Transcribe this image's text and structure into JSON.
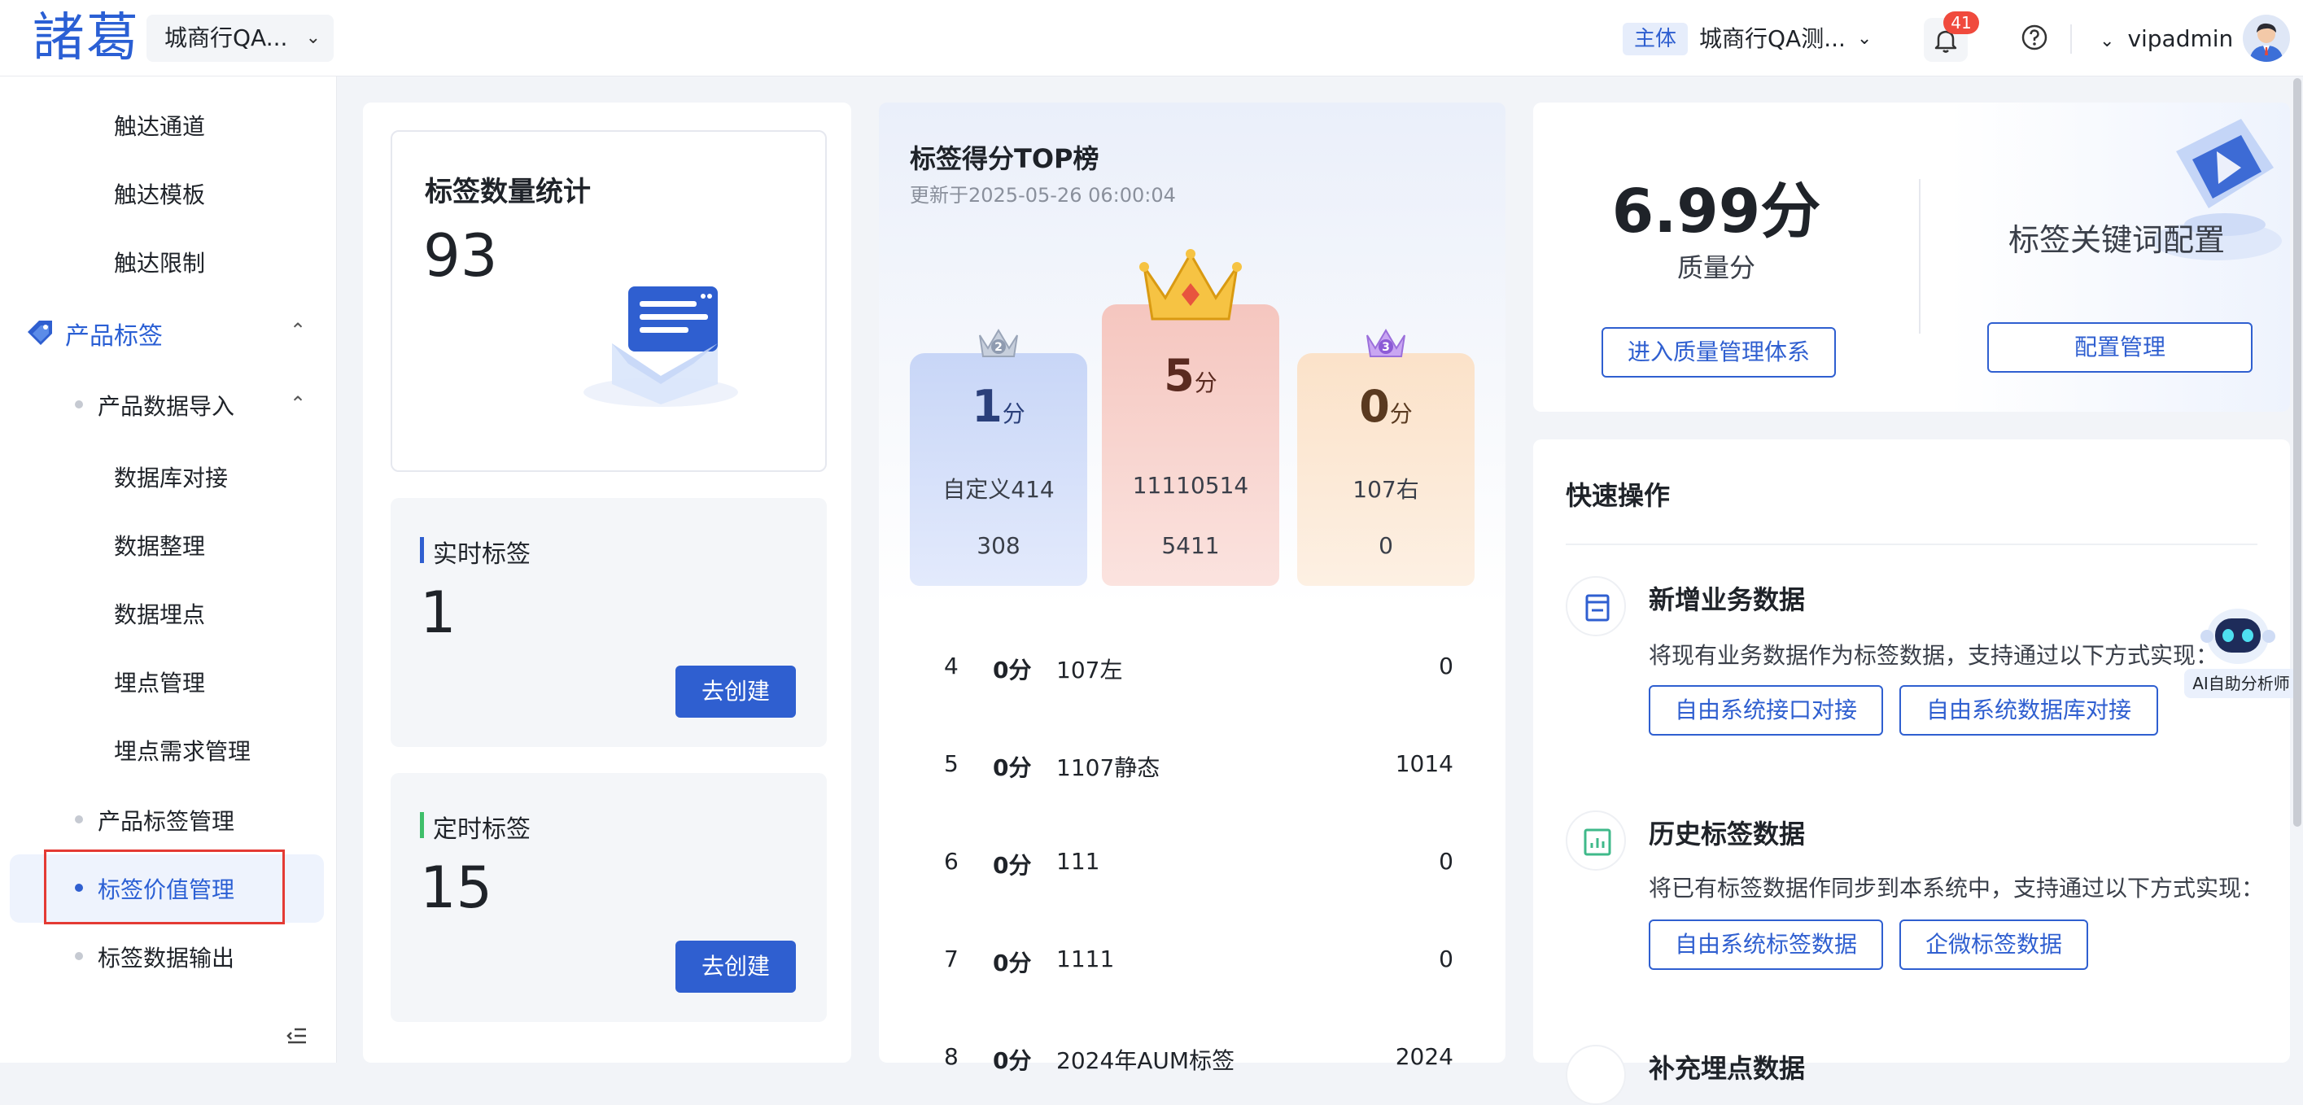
{
  "header": {
    "logo": "諸葛",
    "org": "城商行QA...",
    "entity_tag": "主体",
    "entity_name": "城商行QA测...",
    "notifications": "41",
    "user": "vipadmin"
  },
  "sidebar": {
    "items_top": [
      "触达通道",
      "触达模板",
      "触达限制"
    ],
    "group": "产品标签",
    "sub_group": "产品数据导入",
    "sub_items": [
      "数据库对接",
      "数据整理",
      "数据埋点",
      "埋点管理",
      "埋点需求管理"
    ],
    "l2_items": [
      "产品标签管理",
      "标签价值管理",
      "标签数据输出"
    ]
  },
  "stats": {
    "title": "标签数量统计",
    "total": "93",
    "realtime": {
      "label": "实时标签",
      "value": "1",
      "btn": "去创建"
    },
    "scheduled": {
      "label": "定时标签",
      "value": "15",
      "btn": "去创建"
    }
  },
  "top": {
    "title": "标签得分TOP榜",
    "updated": "更新于2025-05-26 06:00:04",
    "score_unit": "分",
    "podium": [
      {
        "rank": "2",
        "score": "1",
        "name": "自定义414",
        "count": "308"
      },
      {
        "rank": "1",
        "score": "5",
        "name": "11110514",
        "count": "5411"
      },
      {
        "rank": "3",
        "score": "0",
        "name": "107右",
        "count": "0"
      }
    ],
    "rows": [
      {
        "rank": "4",
        "score": "0分",
        "name": "107左",
        "count": "0"
      },
      {
        "rank": "5",
        "score": "0分",
        "name": "1107静态",
        "count": "1014"
      },
      {
        "rank": "6",
        "score": "0分",
        "name": "111",
        "count": "0"
      },
      {
        "rank": "7",
        "score": "0分",
        "name": "1111",
        "count": "0"
      },
      {
        "rank": "8",
        "score": "0分",
        "name": "2024年AUM标签",
        "count": "2024"
      }
    ]
  },
  "quality": {
    "value": "6.99分",
    "label": "质量分",
    "btn": "进入质量管理体系",
    "kw_title": "标签关键词配置",
    "kw_btn": "配置管理"
  },
  "quick": {
    "title": "快速操作",
    "actions": [
      {
        "title": "新增业务数据",
        "desc": "将现有业务数据作为标签数据，支持通过以下方式实现：",
        "btns": [
          "自由系统接口对接",
          "自由系统数据库对接"
        ]
      },
      {
        "title": "历史标签数据",
        "desc": "将已有标签数据作同步到本系统中，支持通过以下方式实现：",
        "btns": [
          "自由系统标签数据",
          "企微标签数据"
        ]
      },
      {
        "title": "补充埋点数据"
      }
    ],
    "ai_label": "AI自助分析师"
  }
}
